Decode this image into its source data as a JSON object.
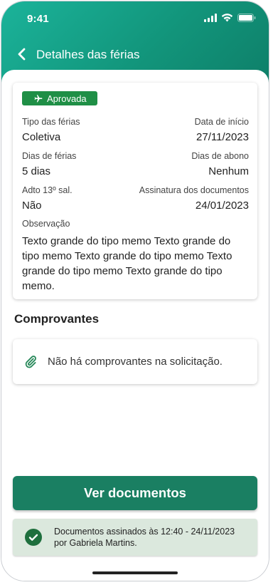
{
  "status_bar": {
    "time": "9:41"
  },
  "header": {
    "title": "Detalhes das férias"
  },
  "vacation": {
    "status_badge": "Aprovada",
    "type_label": "Tipo das férias",
    "type_value": "Coletiva",
    "start_label": "Data de início",
    "start_value": "27/11/2023",
    "days_label": "Dias de férias",
    "days_value": "5 dias",
    "bonus_label": "Dias de abono",
    "bonus_value": "Nenhum",
    "advance_label": "Adto 13º sal.",
    "advance_value": "Não",
    "signature_label": "Assinatura dos documentos",
    "signature_value": "24/01/2023",
    "note_label": "Observação",
    "note_text": "Texto grande do tipo memo Texto grande do tipo memo Texto grande do tipo memo Texto grande do tipo memo Texto grande do tipo memo."
  },
  "receipts": {
    "title": "Comprovantes",
    "empty_message": "Não há comprovantes na solicitação."
  },
  "actions": {
    "view_documents": "Ver documentos"
  },
  "signed_notice": {
    "text": "Documentos assinados às 12:40 - 24/11/2023 por Gabriela Martins."
  },
  "colors": {
    "primary": "#1a7f62",
    "badge": "#1f8f46",
    "notice_bg": "#dbe8dd",
    "header_gradient_start": "#1bb39a"
  },
  "icons": [
    "back-chevron-icon",
    "airplane-icon",
    "paperclip-icon",
    "check-circle-icon",
    "signal-icon",
    "wifi-icon",
    "battery-icon"
  ]
}
